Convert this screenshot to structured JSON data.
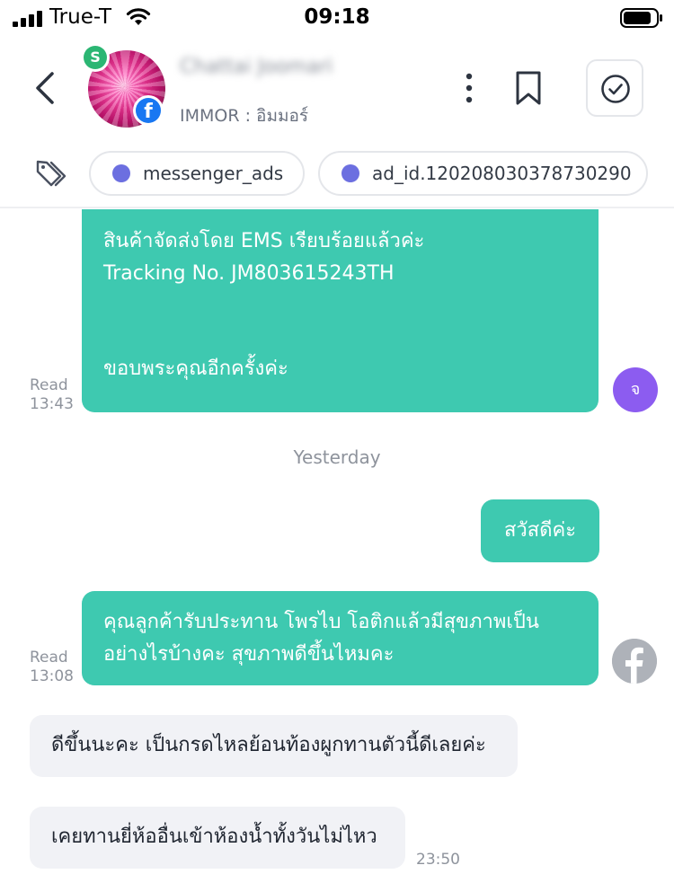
{
  "status_bar": {
    "carrier": "True-T",
    "time": "09:18"
  },
  "header": {
    "contact_name": "Chattai Joomari",
    "contact_subtitle": "IMMOR : อิมมอร์",
    "avatar_badge_letter": "S",
    "icons": [
      "back-icon",
      "more-vertical-icon",
      "bookmark-icon",
      "check-circle-icon"
    ]
  },
  "tags": [
    {
      "label": "messenger_ads",
      "color": "#6c6fe0"
    },
    {
      "label": "ad_id.120208030378730290",
      "color": "#6c6fe0"
    }
  ],
  "colors": {
    "outgoing_bubble": "#3ec9b0",
    "incoming_bubble": "#f1f2f6",
    "agent_avatar": "#8c5cf0",
    "facebook_blue": "#1877f2"
  },
  "messages": [
    {
      "direction": "out",
      "lines": [
        "สินค้าจัดส่งโดย EMS เรียบร้อยแล้วค่ะ",
        "Tracking No. JM803615243TH",
        "ขอบพระคุณอีกครั้งค่ะ"
      ],
      "read_label": "Read",
      "time": "13:43",
      "avatar_letter": "จ"
    },
    {
      "separator": "Yesterday"
    },
    {
      "direction": "out",
      "text": "สวัสดีค่ะ"
    },
    {
      "direction": "out",
      "lines": [
        "คุณลูกค้ารับประทาน โพรไบ โอติกแล้วมีสุขภาพเป็น",
        "อย่างไรบ้างคะ สุขภาพดีขึ้นไหมคะ"
      ],
      "read_label": "Read",
      "time": "13:08"
    },
    {
      "direction": "in",
      "text": "ดีขึ้นนะคะ เป็นกรดไหลย้อนท้องผูกทานตัวนี้ดีเลยค่ะ"
    },
    {
      "direction": "in",
      "text": "เคยทานยี่ห้ออื่นเข้าห้องน้ำทั้งวันไม่ไหว",
      "time": "23:50"
    }
  ]
}
